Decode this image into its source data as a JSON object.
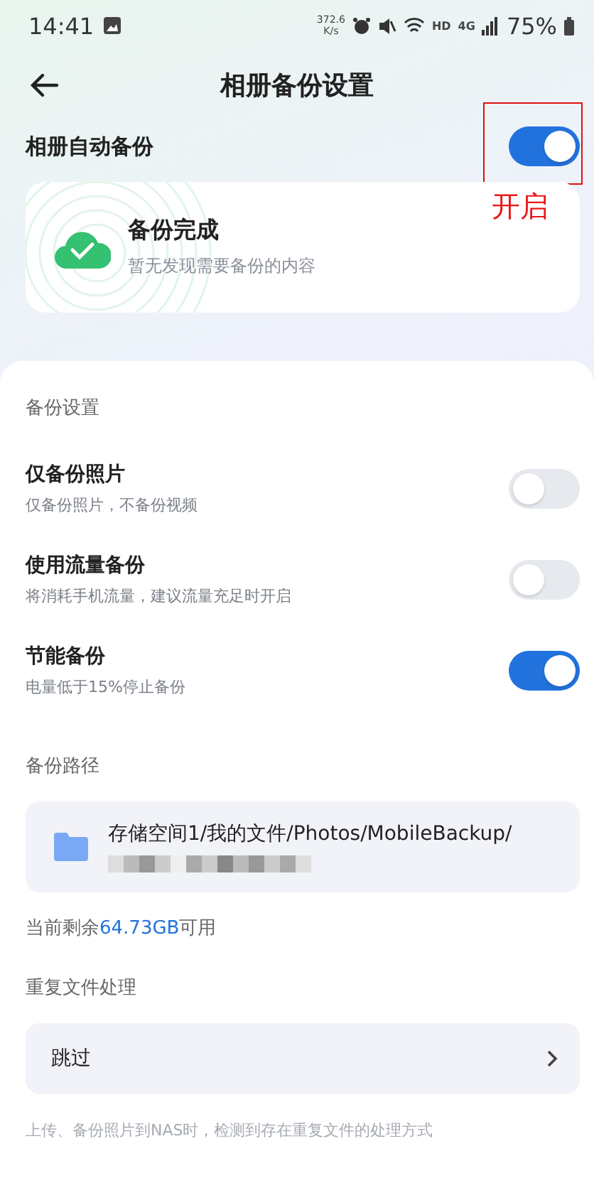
{
  "status_bar": {
    "time": "14:41",
    "net_speed": "372.6",
    "net_unit": "K/s",
    "hd": "HD",
    "network": "4G",
    "battery": "75%"
  },
  "header": {
    "title": "相册备份设置"
  },
  "auto_backup": {
    "label": "相册自动备份",
    "on": true,
    "annotation": "开启"
  },
  "status_card": {
    "title": "备份完成",
    "subtitle": "暂无发现需要备份的内容"
  },
  "settings": {
    "heading": "备份设置",
    "items": [
      {
        "title": "仅备份照片",
        "desc": "仅备份照片，不备份视频",
        "on": false
      },
      {
        "title": "使用流量备份",
        "desc": "将消耗手机流量，建议流量充足时开启",
        "on": false
      },
      {
        "title": "节能备份",
        "desc": "电量低于15%停止备份",
        "on": true
      }
    ]
  },
  "path": {
    "heading": "备份路径",
    "value": "存储空间1/我的文件/Photos/MobileBackup/",
    "free_prefix": "当前剩余",
    "free_amount": "64.73GB",
    "free_suffix": "可用"
  },
  "duplicates": {
    "heading": "重复文件处理",
    "value": "跳过",
    "note": "上传、备份照片到NAS时，检测到存在重复文件的处理方式"
  }
}
